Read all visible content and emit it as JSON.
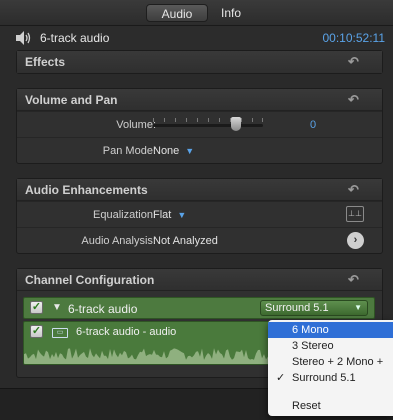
{
  "tabs": {
    "audio": "Audio",
    "info": "Info"
  },
  "header": {
    "clip_title": "6-track audio",
    "timecode": "00:10:52:11",
    "speaker_icon": "speaker-icon"
  },
  "effects": {
    "title": "Effects"
  },
  "volume_pan": {
    "title": "Volume and Pan",
    "volume_label": "Volume:",
    "volume_value": "0",
    "pan_mode_label": "Pan Mode:",
    "pan_mode_value": "None"
  },
  "enhancements": {
    "title": "Audio Enhancements",
    "eq_label": "Equalization:",
    "eq_value": "Flat",
    "analysis_label": "Audio Analysis:",
    "analysis_value": "Not Analyzed"
  },
  "channel_config": {
    "title": "Channel Configuration",
    "track_name": "6-track audio",
    "popup_value": "Surround 5.1",
    "sub_track_name": "6-track audio - audio"
  },
  "menu": {
    "items": [
      "6 Mono",
      "3 Stereo",
      "Stereo + 2 Mono +",
      "Surround 5.1"
    ],
    "highlighted": "6 Mono",
    "checked": "Surround 5.1",
    "reset": "Reset"
  },
  "colors": {
    "accent_blue": "#5aa3e8",
    "track_green": "#4d7a3f",
    "menu_highlight": "#2f6fd6"
  }
}
